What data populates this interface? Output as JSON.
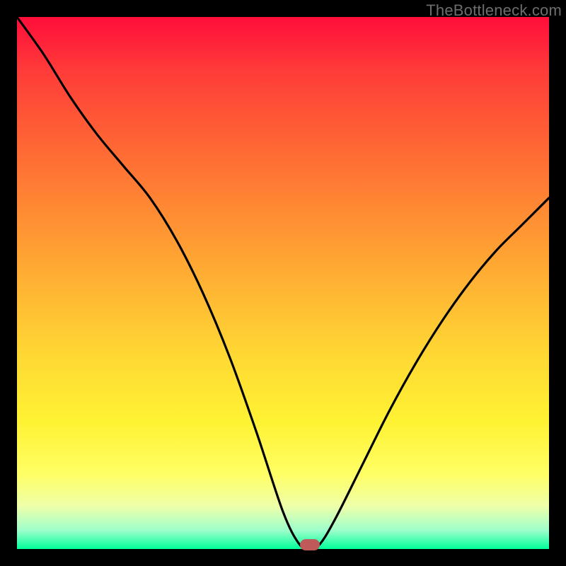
{
  "attribution": "TheBottleneck.com",
  "chart_data": {
    "type": "line",
    "title": "",
    "xlabel": "",
    "ylabel": "",
    "xlim": [
      0,
      100
    ],
    "ylim": [
      0,
      100
    ],
    "grid": false,
    "series": [
      {
        "name": "bottleneck-curve",
        "x": [
          0,
          5,
          10,
          15,
          20,
          25,
          30,
          35,
          40,
          45,
          50,
          53,
          55,
          57,
          60,
          65,
          70,
          75,
          80,
          85,
          90,
          95,
          100
        ],
        "y": [
          100,
          93,
          85,
          78,
          72,
          66,
          58,
          48,
          36,
          22,
          7,
          1,
          0,
          1,
          6,
          16,
          26,
          35,
          43,
          50,
          56,
          61,
          66
        ]
      }
    ],
    "marker": {
      "x": 55,
      "y": 0,
      "color": "#c05a5a"
    },
    "background_gradient": {
      "type": "vertical",
      "stops": [
        {
          "pos": 0.0,
          "color": "#ff0d3a"
        },
        {
          "pos": 0.5,
          "color": "#ffb233"
        },
        {
          "pos": 0.86,
          "color": "#ffff66"
        },
        {
          "pos": 1.0,
          "color": "#00ff99"
        }
      ]
    }
  }
}
